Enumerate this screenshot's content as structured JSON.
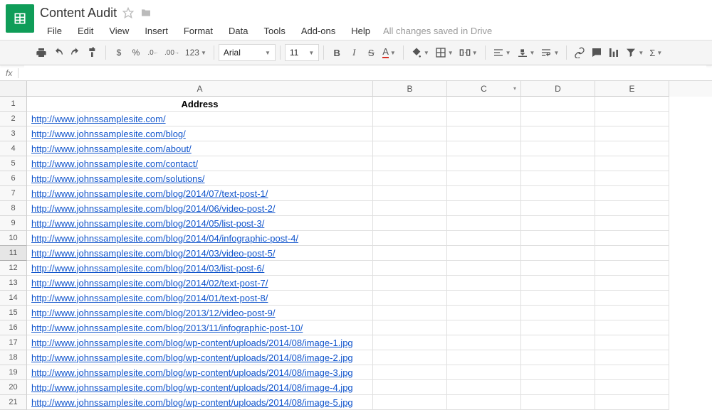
{
  "doc": {
    "title": "Content Audit",
    "save_status": "All changes saved in Drive"
  },
  "menu": [
    "File",
    "Edit",
    "View",
    "Insert",
    "Format",
    "Data",
    "Tools",
    "Add-ons",
    "Help"
  ],
  "toolbar": {
    "font": "Arial",
    "size": "11",
    "currency": "$",
    "percent": "%",
    "dec_less": ".0",
    "dec_more": ".00",
    "num_format": "123",
    "bold": "B",
    "italic": "I",
    "strike": "S",
    "textcolor": "A",
    "sigma": "Σ"
  },
  "columns": [
    "A",
    "B",
    "C",
    "D",
    "E"
  ],
  "header_row": {
    "A": "Address"
  },
  "rows": [
    {
      "n": "1",
      "A": "Address",
      "is_header": true
    },
    {
      "n": "2",
      "A": "http://www.johnssamplesite.com/"
    },
    {
      "n": "3",
      "A": "http://www.johnssamplesite.com/blog/"
    },
    {
      "n": "4",
      "A": "http://www.johnssamplesite.com/about/"
    },
    {
      "n": "5",
      "A": "http://www.johnssamplesite.com/contact/"
    },
    {
      "n": "6",
      "A": "http://www.johnssamplesite.com/solutions/"
    },
    {
      "n": "7",
      "A": "http://www.johnssamplesite.com/blog/2014/07/text-post-1/"
    },
    {
      "n": "8",
      "A": "http://www.johnssamplesite.com/blog/2014/06/video-post-2/"
    },
    {
      "n": "9",
      "A": "http://www.johnssamplesite.com/blog/2014/05/list-post-3/"
    },
    {
      "n": "10",
      "A": "http://www.johnssamplesite.com/blog/2014/04/infographic-post-4/"
    },
    {
      "n": "11",
      "A": "http://www.johnssamplesite.com/blog/2014/03/video-post-5/",
      "selected": true
    },
    {
      "n": "12",
      "A": "http://www.johnssamplesite.com/blog/2014/03/list-post-6/"
    },
    {
      "n": "13",
      "A": "http://www.johnssamplesite.com/blog/2014/02/text-post-7/"
    },
    {
      "n": "14",
      "A": "http://www.johnssamplesite.com/blog/2014/01/text-post-8/"
    },
    {
      "n": "15",
      "A": "http://www.johnssamplesite.com/blog/2013/12/video-post-9/"
    },
    {
      "n": "16",
      "A": "http://www.johnssamplesite.com/blog/2013/11/infographic-post-10/"
    },
    {
      "n": "17",
      "A": "http://www.johnssamplesite.com/blog/wp-content/uploads/2014/08/image-1.jpg"
    },
    {
      "n": "18",
      "A": "http://www.johnssamplesite.com/blog/wp-content/uploads/2014/08/image-2.jpg"
    },
    {
      "n": "19",
      "A": "http://www.johnssamplesite.com/blog/wp-content/uploads/2014/08/image-3.jpg"
    },
    {
      "n": "20",
      "A": "http://www.johnssamplesite.com/blog/wp-content/uploads/2014/08/image-4.jpg"
    },
    {
      "n": "21",
      "A": "http://www.johnssamplesite.com/blog/wp-content/uploads/2014/08/image-5.jpg"
    }
  ],
  "fx_label": "fx"
}
